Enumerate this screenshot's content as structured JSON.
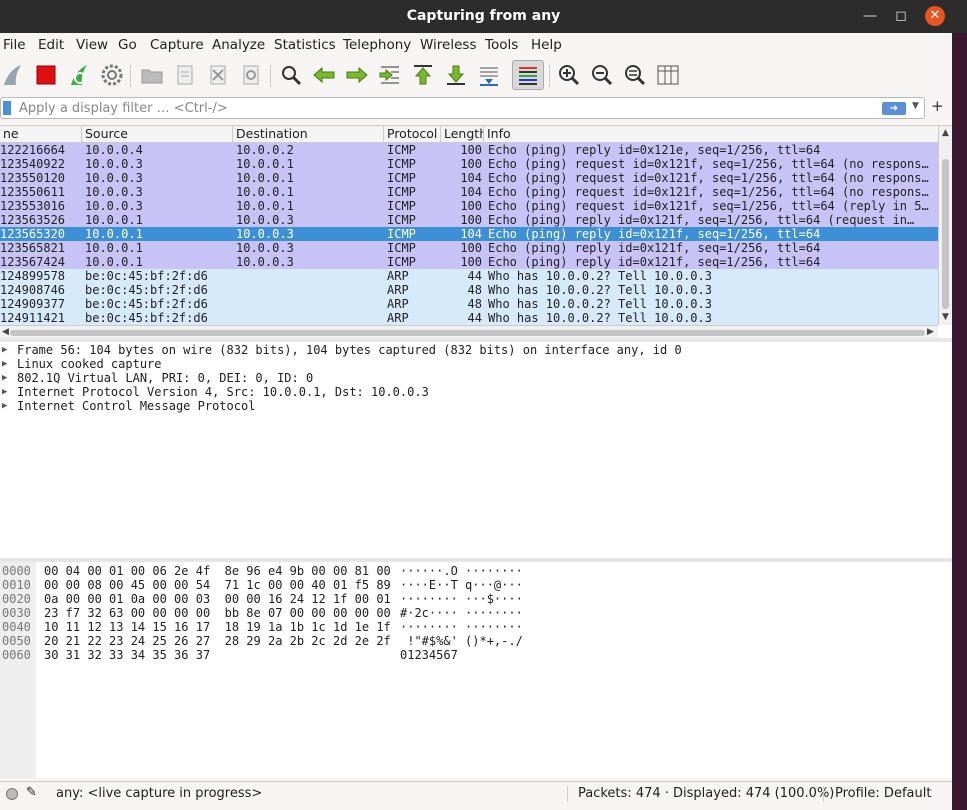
{
  "window": {
    "title": "Capturing from any"
  },
  "menu": [
    "File",
    "Edit",
    "View",
    "Go",
    "Capture",
    "Analyze",
    "Statistics",
    "Telephony",
    "Wireless",
    "Tools",
    "Help"
  ],
  "filter": {
    "placeholder": "Apply a display filter … <Ctrl-/>"
  },
  "columns": {
    "no": "ne",
    "src": "Source",
    "dst": "Destination",
    "proto": "Protocol",
    "len": "Length",
    "info": "Info"
  },
  "packets": [
    {
      "no": "122216664",
      "src": "10.0.0.4",
      "dst": "10.0.0.2",
      "proto": "ICMP",
      "len": "100",
      "info": "Echo (ping) reply    id=0x121e, seq=1/256, ttl=64",
      "kind": "icmp"
    },
    {
      "no": "123540922",
      "src": "10.0.0.3",
      "dst": "10.0.0.1",
      "proto": "ICMP",
      "len": "100",
      "info": "Echo (ping) request  id=0x121f, seq=1/256, ttl=64 (no respons…",
      "kind": "icmp"
    },
    {
      "no": "123550120",
      "src": "10.0.0.3",
      "dst": "10.0.0.1",
      "proto": "ICMP",
      "len": "104",
      "info": "Echo (ping) request  id=0x121f, seq=1/256, ttl=64 (no respons…",
      "kind": "icmp"
    },
    {
      "no": "123550611",
      "src": "10.0.0.3",
      "dst": "10.0.0.1",
      "proto": "ICMP",
      "len": "104",
      "info": "Echo (ping) request  id=0x121f, seq=1/256, ttl=64 (no respons…",
      "kind": "icmp"
    },
    {
      "no": "123553016",
      "src": "10.0.0.3",
      "dst": "10.0.0.1",
      "proto": "ICMP",
      "len": "100",
      "info": "Echo (ping) request  id=0x121f, seq=1/256, ttl=64 (reply in 5…",
      "kind": "icmp"
    },
    {
      "no": "123563526",
      "src": "10.0.0.1",
      "dst": "10.0.0.3",
      "proto": "ICMP",
      "len": "100",
      "info": "Echo (ping) reply    id=0x121f, seq=1/256, ttl=64 (request in…",
      "kind": "icmp"
    },
    {
      "no": "123565320",
      "src": "10.0.0.1",
      "dst": "10.0.0.3",
      "proto": "ICMP",
      "len": "104",
      "info": "Echo (ping) reply    id=0x121f, seq=1/256, ttl=64",
      "kind": "sel"
    },
    {
      "no": "123565821",
      "src": "10.0.0.1",
      "dst": "10.0.0.3",
      "proto": "ICMP",
      "len": "100",
      "info": "Echo (ping) reply    id=0x121f, seq=1/256, ttl=64",
      "kind": "icmp"
    },
    {
      "no": "123567424",
      "src": "10.0.0.1",
      "dst": "10.0.0.3",
      "proto": "ICMP",
      "len": "100",
      "info": "Echo (ping) reply    id=0x121f, seq=1/256, ttl=64",
      "kind": "icmp"
    },
    {
      "no": "124899578",
      "src": "be:0c:45:bf:2f:d6",
      "dst": "",
      "proto": "ARP",
      "len": "44",
      "info": "Who has 10.0.0.2? Tell 10.0.0.3",
      "kind": "arp"
    },
    {
      "no": "124908746",
      "src": "be:0c:45:bf:2f:d6",
      "dst": "",
      "proto": "ARP",
      "len": "48",
      "info": "Who has 10.0.0.2? Tell 10.0.0.3",
      "kind": "arp"
    },
    {
      "no": "124909377",
      "src": "be:0c:45:bf:2f:d6",
      "dst": "",
      "proto": "ARP",
      "len": "48",
      "info": "Who has 10.0.0.2? Tell 10.0.0.3",
      "kind": "arp"
    },
    {
      "no": "124911421",
      "src": "be:0c:45:bf:2f:d6",
      "dst": "",
      "proto": "ARP",
      "len": "44",
      "info": "Who has 10.0.0.2? Tell 10.0.0.3",
      "kind": "arp"
    }
  ],
  "details": [
    "Frame 56: 104 bytes on wire (832 bits), 104 bytes captured (832 bits) on interface any, id 0",
    "Linux cooked capture",
    "802.1Q Virtual LAN, PRI: 0, DEI: 0, ID: 0",
    "Internet Protocol Version 4, Src: 10.0.0.1, Dst: 10.0.0.3",
    "Internet Control Message Protocol"
  ],
  "bytes": [
    {
      "off": "0000",
      "hex": "00 04 00 01 00 06 2e 4f  8e 96 e4 9b 00 00 81 00",
      "ascii": "······.O ········"
    },
    {
      "off": "0010",
      "hex": "00 00 08 00 45 00 00 54  71 1c 00 00 40 01 f5 89",
      "ascii": "····E··T q···@···"
    },
    {
      "off": "0020",
      "hex": "0a 00 00 01 0a 00 00 03  00 00 16 24 12 1f 00 01",
      "ascii": "········ ···$····"
    },
    {
      "off": "0030",
      "hex": "23 f7 32 63 00 00 00 00  bb 8e 07 00 00 00 00 00",
      "ascii": "#·2c···· ········"
    },
    {
      "off": "0040",
      "hex": "10 11 12 13 14 15 16 17  18 19 1a 1b 1c 1d 1e 1f",
      "ascii": "········ ········"
    },
    {
      "off": "0050",
      "hex": "20 21 22 23 24 25 26 27  28 29 2a 2b 2c 2d 2e 2f",
      "ascii": " !\"#$%&' ()*+,-./"
    },
    {
      "off": "0060",
      "hex": "30 31 32 33 34 35 36 37",
      "ascii": "01234567"
    }
  ],
  "status": {
    "filter": "any: <live capture in progress>",
    "packets": "Packets: 474 · Displayed: 474 (100.0%)",
    "profile": "Profile: Default"
  },
  "colors": {
    "icmp_row": "#c7c3f7",
    "arp_row": "#d7eafb",
    "selected_row": "#3d8fd6",
    "close_button": "#e95420"
  },
  "toolbar_icons": [
    "shark-fin-start-icon",
    "stop-icon",
    "restart-icon",
    "options-gear-icon",
    "open-folder-icon",
    "save-file-icon",
    "close-file-icon",
    "reload-icon",
    "find-icon",
    "back-arrow-icon",
    "forward-arrow-icon",
    "go-to-packet-icon",
    "first-packet-icon",
    "last-packet-icon",
    "autoscroll-icon",
    "colorize-icon",
    "zoom-in-icon",
    "zoom-out-icon",
    "normal-size-icon",
    "resize-columns-icon"
  ]
}
